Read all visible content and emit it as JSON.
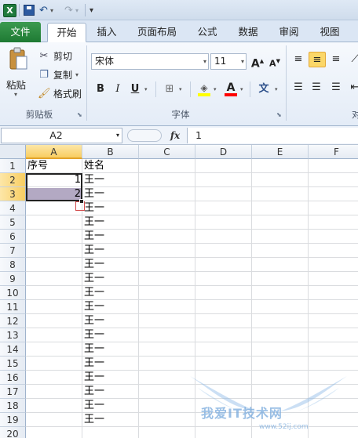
{
  "quick_access": {
    "app_icon": "excel-logo-icon",
    "app_icon_letter": "X",
    "save_icon": "save-icon",
    "undo_glyph": "↶",
    "redo_glyph": "↷",
    "customize_glyph": "▾"
  },
  "tabs": [
    {
      "label": "文件"
    },
    {
      "label": "开始"
    },
    {
      "label": "插入"
    },
    {
      "label": "页面布局"
    },
    {
      "label": "公式"
    },
    {
      "label": "数据"
    },
    {
      "label": "审阅"
    },
    {
      "label": "视图"
    }
  ],
  "ribbon": {
    "clipboard": {
      "paste_label": "粘贴",
      "cut_label": "剪切",
      "copy_label": "复制",
      "format_painter_label": "格式刷",
      "group_label": "剪贴板"
    },
    "font": {
      "font_name": "宋体",
      "font_size": "11",
      "grow_label": "A",
      "shrink_label": "A",
      "bold": "B",
      "italic": "I",
      "underline": "U",
      "group_label": "字体",
      "fill_color": "#ffff00",
      "font_color": "#ff0000",
      "phonetic_label": "文"
    },
    "alignment": {
      "partial_label": "对"
    }
  },
  "formula_bar": {
    "name_box": "A2",
    "fx_label": "fx",
    "content": "1"
  },
  "sheet": {
    "columns": [
      "A",
      "B",
      "C",
      "D",
      "E",
      "F"
    ],
    "rows": [
      "1",
      "2",
      "3",
      "4",
      "5",
      "6",
      "7",
      "8",
      "9",
      "10",
      "11",
      "12",
      "13",
      "14",
      "15",
      "16",
      "17",
      "18",
      "19",
      "20"
    ],
    "cells": {
      "A1": "序号",
      "B1": "姓名",
      "A2": "1",
      "A3": "2",
      "B2": "王一",
      "B3": "王一",
      "B4": "王一",
      "B5": "王一",
      "B6": "王一",
      "B7": "王一",
      "B8": "王一",
      "B9": "王一",
      "B10": "王一",
      "B11": "王一",
      "B12": "王一",
      "B13": "王一",
      "B14": "王一",
      "B15": "王一",
      "B16": "王一",
      "B17": "王一",
      "B18": "王一",
      "B19": "王一"
    },
    "selection": "A2:A3"
  },
  "watermark": {
    "text": "我爱IT技术网",
    "url": "www.52ij.com"
  }
}
